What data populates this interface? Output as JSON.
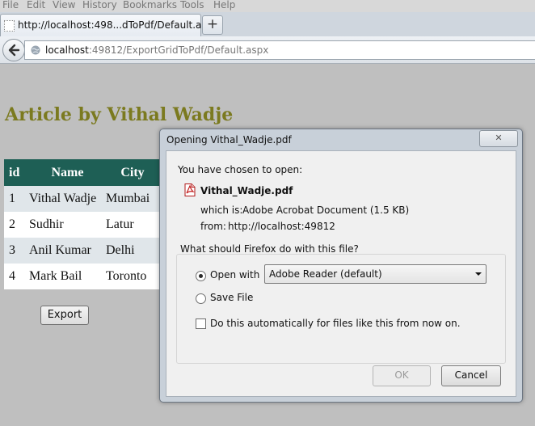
{
  "menu": [
    "File",
    "Edit",
    "View",
    "History",
    "Bookmarks",
    "Tools",
    "Help"
  ],
  "tab": {
    "title": "http://localhost:498...dToPdf/Default.aspx",
    "new_tab": "+"
  },
  "address": {
    "host": "localhost",
    "rest": ":49812/ExportGridToPdf/Default.aspx"
  },
  "page": {
    "title": "Article by Vithal Wadje",
    "grid": {
      "headers": [
        "id",
        "Name",
        "City"
      ],
      "rows": [
        [
          "1",
          "Vithal Wadje",
          "Mumbai"
        ],
        [
          "2",
          "Sudhir",
          "Latur"
        ],
        [
          "3",
          "Anil Kumar",
          "Delhi"
        ],
        [
          "4",
          "Mark Bail",
          "Toronto"
        ]
      ]
    },
    "export_label": "Export"
  },
  "dialog": {
    "title": "Opening Vithal_Wadje.pdf",
    "close": "✕",
    "chosen_text": "You have chosen to open:",
    "filename": "Vithal_Wadje.pdf",
    "which_is_label": "which is:",
    "which_is_value": "Adobe Acrobat Document (1.5 KB)",
    "from_label": "from:",
    "from_value": "http://localhost:49812",
    "question": "What should Firefox do with this file?",
    "open_with_label": "Open with",
    "open_with_app": "Adobe Reader  (default)",
    "save_file_label": "Save File",
    "auto_label": "Do this automatically for files like this from now on.",
    "ok": "OK",
    "cancel": "Cancel"
  }
}
